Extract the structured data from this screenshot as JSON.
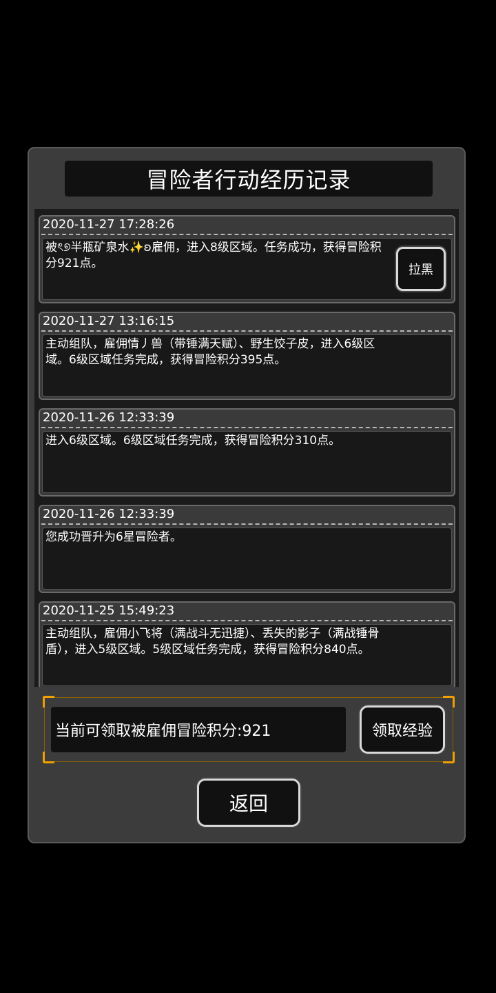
{
  "dialog": {
    "title": "冒险者行动经历记录"
  },
  "log": {
    "entries": [
      {
        "time": "2020-11-27 17:28:26",
        "text": "被ৎ୭半瓶矿泉水✨ʚ雇佣，进入8级区域。任务成功，获得冒险积分921点。",
        "action": "拉黑"
      },
      {
        "time": "2020-11-27 13:16:15",
        "text": "主动组队，雇佣情丿兽（带锤满天赋）、野生饺子皮，进入6级区域。6级区域任务完成，获得冒险积分395点。"
      },
      {
        "time": "2020-11-26 12:33:39",
        "text": "进入6级区域。6级区域任务完成，获得冒险积分310点。"
      },
      {
        "time": "2020-11-26 12:33:39",
        "text": "您成功晋升为6星冒险者。"
      },
      {
        "time": "2020-11-25 15:49:23",
        "text": "主动组队，雇佣小飞将（满战斗无迅捷）、丢失的影子（满战锤骨盾），进入5级区域。5级区域任务完成，获得冒险积分840点。"
      }
    ]
  },
  "claim": {
    "info": "当前可领取被雇佣冒险积分:921",
    "button": "领取经验"
  },
  "footer": {
    "back": "返回"
  },
  "colors": {
    "accent": "#f0a000",
    "panel": "#3c3c3c",
    "background": "#000000"
  }
}
